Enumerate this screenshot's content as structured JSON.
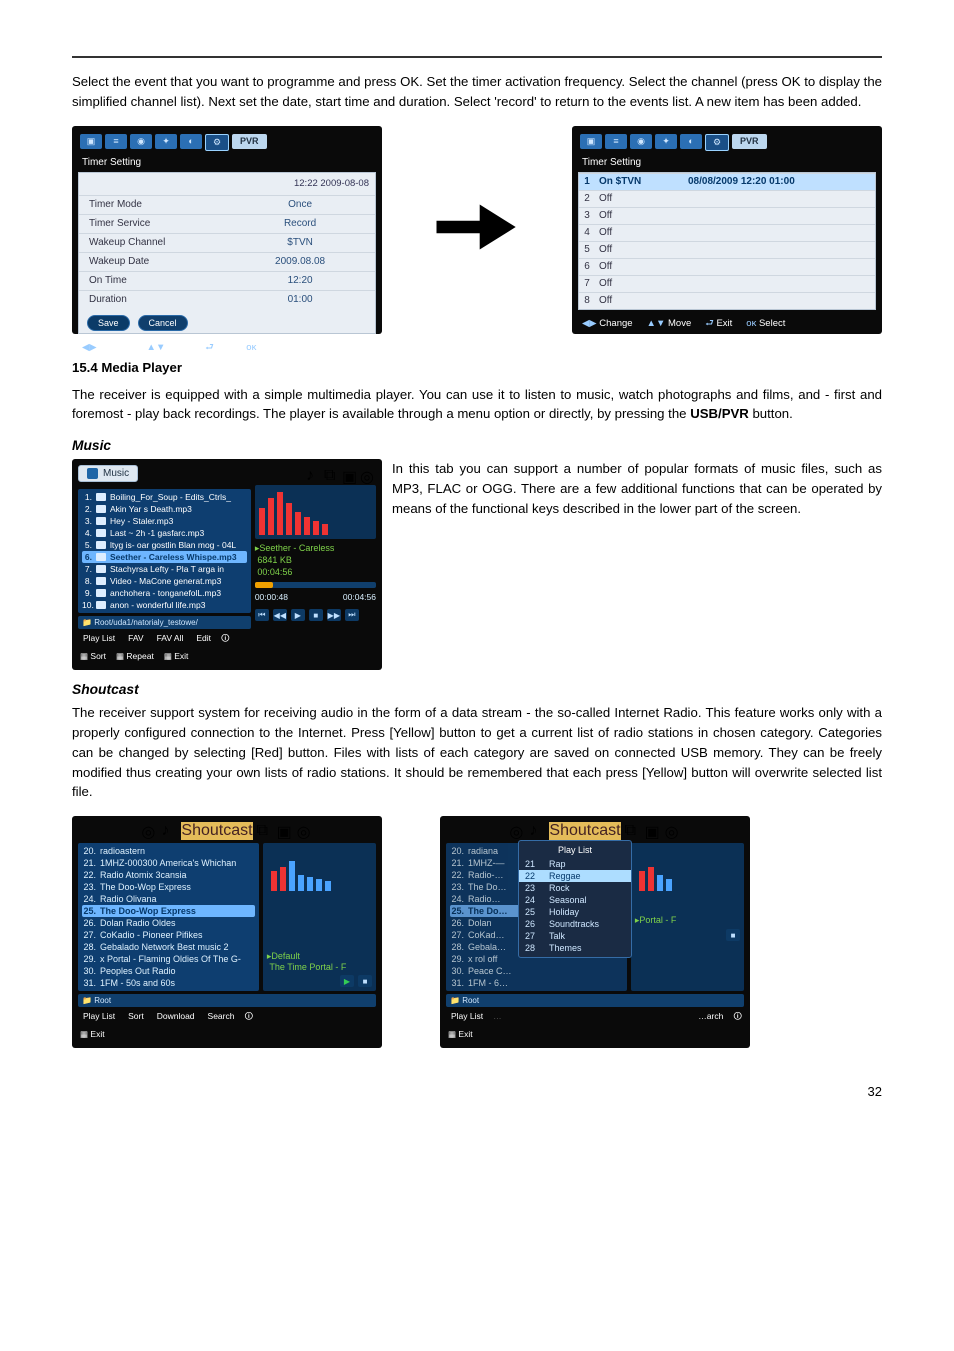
{
  "intro_paragraph": "Select the event that you want to programme and press OK. Set the timer activation frequency. Select the channel (press OK to display the simplified channel list). Next set the date, start time and duration. Select 'record' to return to the events list. A new item has been added.",
  "timer_left": {
    "logo_label": "PVR",
    "panel_title": "Timer Setting",
    "timestamp": "12:22 2009-08-08",
    "rows": [
      {
        "label": "Timer Mode",
        "value": "Once"
      },
      {
        "label": "Timer Service",
        "value": "Record"
      },
      {
        "label": "Wakeup Channel",
        "value": "$TVN"
      },
      {
        "label": "Wakeup Date",
        "value": "2009.08.08"
      },
      {
        "label": "On Time",
        "value": "12:20"
      },
      {
        "label": "Duration",
        "value": "01:00"
      }
    ],
    "save_btn": "Save",
    "cancel_btn": "Cancel",
    "footer": {
      "change": "Change",
      "move": "Move",
      "exit": "Exit",
      "select": "Select"
    }
  },
  "timer_right": {
    "logo_label": "PVR",
    "panel_title": "Timer Setting",
    "items": [
      {
        "idx": "1",
        "status": "On  $TVN",
        "detail": "08/08/2009 12:20  01:00",
        "hi": true
      },
      {
        "idx": "2",
        "status": "Off",
        "detail": ""
      },
      {
        "idx": "3",
        "status": "Off",
        "detail": ""
      },
      {
        "idx": "4",
        "status": "Off",
        "detail": ""
      },
      {
        "idx": "5",
        "status": "Off",
        "detail": ""
      },
      {
        "idx": "6",
        "status": "Off",
        "detail": ""
      },
      {
        "idx": "7",
        "status": "Off",
        "detail": ""
      },
      {
        "idx": "8",
        "status": "Off",
        "detail": ""
      }
    ],
    "footer": {
      "change": "Change",
      "move": "Move",
      "exit": "Exit",
      "select": "Select"
    }
  },
  "media_player": {
    "heading": "15.4 Media Player",
    "paragraph": "The receiver is equipped with a simple multimedia player. You can use it to listen to music, watch photographs and films, and - first and foremost - play back recordings. The player is available through a menu option or directly, by pressing the ",
    "bold_button": "USB/PVR",
    "paragraph_tail": " button."
  },
  "music": {
    "heading": "Music",
    "paragraph": "In this tab you can support a number of popular formats of music files, such as MP3, FLAC or OGG. There are a few additional functions that can be operated by means of the functional keys described in the lower part of the screen.",
    "shot": {
      "tab_label": "Music",
      "files": [
        "Boiling_For_Soup - Edits_Ctrls_",
        "Akin Yar s Death.mp3",
        "Hey - Staler.mp3",
        "Last ~ 2h -1 gasfarc.mp3",
        "ltyg is- oar gostlin Blan mog - 04L",
        "Seether - Careless Whispe.mp3",
        "Stachyrsa Lefty - Pla T arga in",
        "Video - MaCone generat.mp3",
        "anchohera - tonganefolL.mp3",
        "anon - wonderful life.mp3"
      ],
      "path": "Root/uda1/natorialy_testowe/",
      "now1": "Seether - Careless",
      "size": "6841 KB",
      "dur": "00:04:56",
      "time_elapsed": "00:00:48",
      "time_total": "00:04:56",
      "legend": {
        "playlist": "Play List",
        "fav": "FAV",
        "favall": "FAV All",
        "edit": "Edit",
        "sort": "Sort",
        "repeat": "Repeat",
        "exit": "Exit"
      }
    }
  },
  "shoutcast": {
    "heading": "Shoutcast",
    "paragraph": "The receiver support system for receiving audio in the form of a data stream - the so-called Internet Radio. This feature works only with a properly configured connection to the Internet. Press [Yellow] button to get a current list of radio stations in chosen category. Categories can be changed by selecting [Red] button. Files with lists of each category are saved on connected USB memory. They can be freely modified thus creating your own lists of radio stations. It should be remembered that each press [Yellow] button will overwrite selected list file.",
    "left": {
      "tab_label": "Shoutcast",
      "stations": [
        "radioastern",
        "1MHZ-000300 America's Whichan",
        "Radio Atomix 3cansia",
        "The Doo-Wop Express",
        "Radio Olivana",
        "The Doo-Wop Express",
        "Dolan Radio Oldes",
        "CoKadio - Pioneer Pifikes",
        "Gebalado Network Best music 2",
        "x Portal - Flaming Oldies Of The G-",
        "Peoples Out Radio",
        "1FM - 50s and 60s"
      ],
      "rootline": "Root",
      "now": "Default",
      "now2": "The Time Portal - F",
      "legend": {
        "playlist": "Play List",
        "sort": "Sort",
        "download": "Download",
        "search": "Search",
        "exit": "Exit"
      }
    },
    "right": {
      "tab_label": "Shoutcast",
      "stations_bg": [
        "radiana",
        "1MHZ-—",
        "Radio-…",
        "The Do…",
        "Radio…",
        "The Do…",
        "Dolan",
        "CoKad…",
        "Gebala…",
        "x rol off",
        "Peace C…",
        "1FM - 6…"
      ],
      "rootline": "Root",
      "cat_header": "Play List",
      "categories": [
        {
          "n": "21",
          "name": "Rap"
        },
        {
          "n": "22",
          "name": "Reggae"
        },
        {
          "n": "23",
          "name": "Rock"
        },
        {
          "n": "24",
          "name": "Seasonal"
        },
        {
          "n": "25",
          "name": "Holiday"
        },
        {
          "n": "26",
          "name": "Soundtracks"
        },
        {
          "n": "27",
          "name": "Talk"
        },
        {
          "n": "28",
          "name": "Themes"
        }
      ],
      "now2": "Portal - F",
      "legend": {
        "playlist": "Play List",
        "search_tail": "arch",
        "exit": "Exit"
      }
    }
  },
  "page_number": "32"
}
